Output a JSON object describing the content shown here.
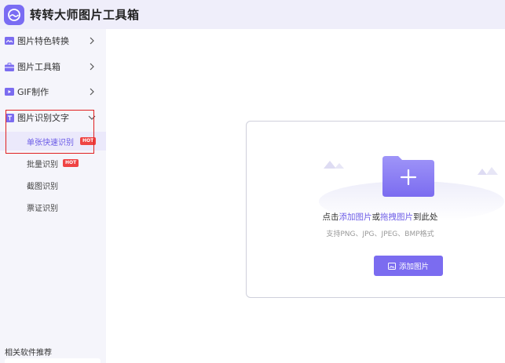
{
  "app": {
    "title": "转转大师图片工具箱",
    "accent_color": "#7b6cf0",
    "logo_icon": "photo-wave-icon"
  },
  "sidebar": {
    "categories": [
      {
        "label": "图片特色转换",
        "icon": "image-convert-icon",
        "expanded": false
      },
      {
        "label": "图片工具箱",
        "icon": "toolbox-icon",
        "expanded": false
      },
      {
        "label": "GIF制作",
        "icon": "gif-icon",
        "expanded": false
      },
      {
        "label": "图片识别文字",
        "icon": "text-recognize-icon",
        "expanded": true
      }
    ],
    "sub_items": [
      {
        "label": "单张快速识别",
        "badge": "HOT",
        "active": true
      },
      {
        "label": "批量识别",
        "badge": "HOT",
        "active": false
      },
      {
        "label": "截图识别",
        "badge": "",
        "active": false
      },
      {
        "label": "票证识别",
        "badge": "",
        "active": false
      }
    ],
    "recommend_label": "相关软件推荐"
  },
  "upload": {
    "hint_prefix": "点击",
    "hint_link_add": "添加图片",
    "hint_or": "或",
    "hint_link_drag": "拖拽图片",
    "hint_suffix": "到此处",
    "formats": "支持PNG、JPG、JPEG、BMP格式",
    "button_label": "添加图片"
  }
}
